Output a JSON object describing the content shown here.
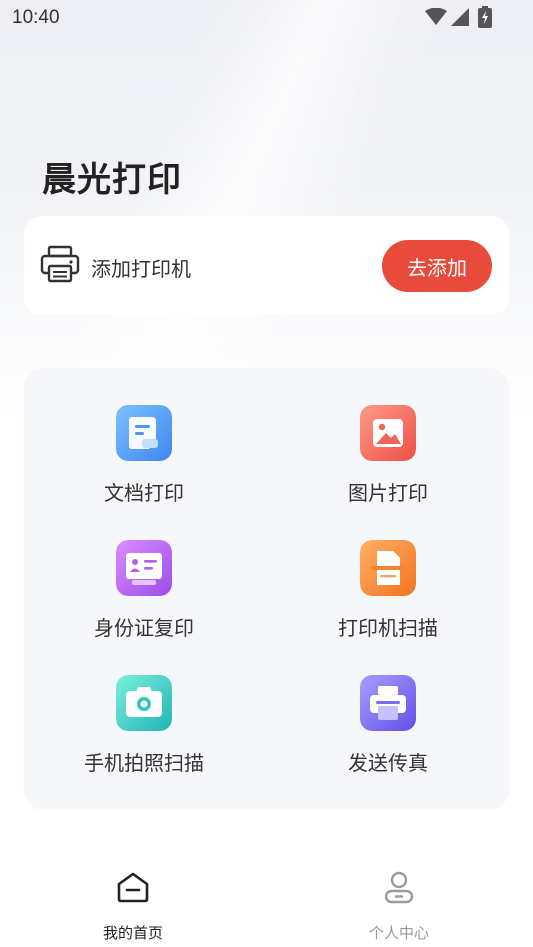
{
  "status_bar": {
    "time": "10:40",
    "icons": [
      "wifi-icon",
      "signal-icon",
      "battery-charging-icon"
    ]
  },
  "header": {
    "title": "晨光打印"
  },
  "printer_card": {
    "icon": "printer-icon",
    "label": "添加打印机",
    "button_label": "去添加",
    "button_color": "#e84b3c"
  },
  "features": [
    {
      "label": "文档打印",
      "icon": "document-icon",
      "color": "#4d96f0"
    },
    {
      "label": "图片打印",
      "icon": "image-icon",
      "color": "#f0655a"
    },
    {
      "label": "身份证复印",
      "icon": "id-card-icon",
      "color": "#b45ef0"
    },
    {
      "label": "打印机扫描",
      "icon": "scan-icon",
      "color": "#f5842e"
    },
    {
      "label": "手机拍照扫描",
      "icon": "camera-icon",
      "color": "#2fc6c0"
    },
    {
      "label": "发送传真",
      "icon": "fax-icon",
      "color": "#7a6ef0"
    }
  ],
  "bottom_nav": {
    "items": [
      {
        "label": "我的首页",
        "icon": "home-icon",
        "active": true
      },
      {
        "label": "个人中心",
        "icon": "user-icon",
        "active": false
      }
    ],
    "active_color": "#222222",
    "inactive_color": "#999999"
  }
}
